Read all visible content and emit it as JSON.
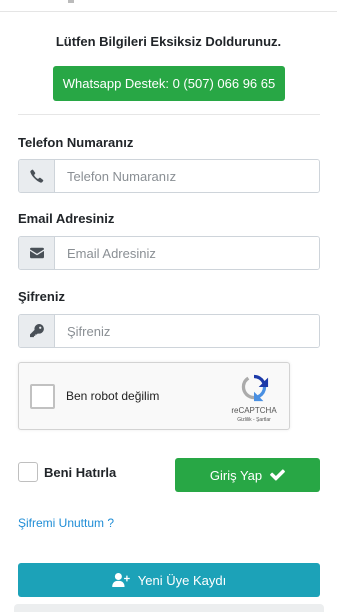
{
  "heading": "Lütfen Bilgileri Eksiksiz Doldurunuz.",
  "whatsapp_button": "Whatsapp Destek: 0 (507) 066 96 65",
  "phone": {
    "label": "Telefon Numaranız",
    "placeholder": "Telefon Numaranız",
    "icon": "phone-icon"
  },
  "email": {
    "label": "Email Adresiniz",
    "placeholder": "Email Adresiniz",
    "icon": "envelope-icon"
  },
  "password": {
    "label": "Şifreniz",
    "placeholder": "Şifreniz",
    "icon": "key-icon"
  },
  "captcha": {
    "text": "Ben robot değilim",
    "brand": "reCAPTCHA",
    "terms": "Gizlilik - Şartlar"
  },
  "remember": "Beni Hatırla",
  "login_button": "Giriş Yap",
  "forgot_link": "Şifremi Unuttum ?",
  "register_button": "Yeni Üye Kaydı",
  "colors": {
    "green": "#28a745",
    "teal": "#1ca2b8",
    "link": "#1f8dd6"
  }
}
